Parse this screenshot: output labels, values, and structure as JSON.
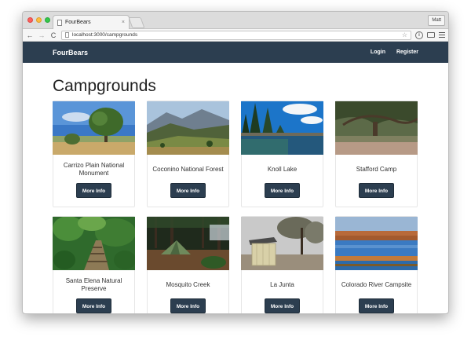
{
  "browser": {
    "tab_title": "FourBears",
    "tab_close": "×",
    "url": "localhost:3000/campgrounds",
    "user_button": "Matt",
    "back_icon": "←",
    "forward_icon": "→",
    "reload_icon": "C",
    "star_icon": "☆",
    "info_icon": "i"
  },
  "nav": {
    "brand": "FourBears",
    "login": "Login",
    "register": "Register"
  },
  "page": {
    "title": "Campgrounds",
    "more_info_label": "More Info"
  },
  "campgrounds": [
    {
      "name": "Carrizo Plain National Monument",
      "scene": "oak-plain"
    },
    {
      "name": "Coconino National Forest",
      "scene": "mountain-valley"
    },
    {
      "name": "Knoll Lake",
      "scene": "lake-pines"
    },
    {
      "name": "Stafford Camp",
      "scene": "oak-canopy"
    },
    {
      "name": "Santa Elena Natural Preserve",
      "scene": "jungle-trail"
    },
    {
      "name": "Mosquito Creek",
      "scene": "forest-tent"
    },
    {
      "name": "La Junta",
      "scene": "shed-trees"
    },
    {
      "name": "Colorado River Campsite",
      "scene": "river-dusk"
    }
  ],
  "colors": {
    "navbar": "#2c3e50",
    "button": "#2c3e50"
  }
}
